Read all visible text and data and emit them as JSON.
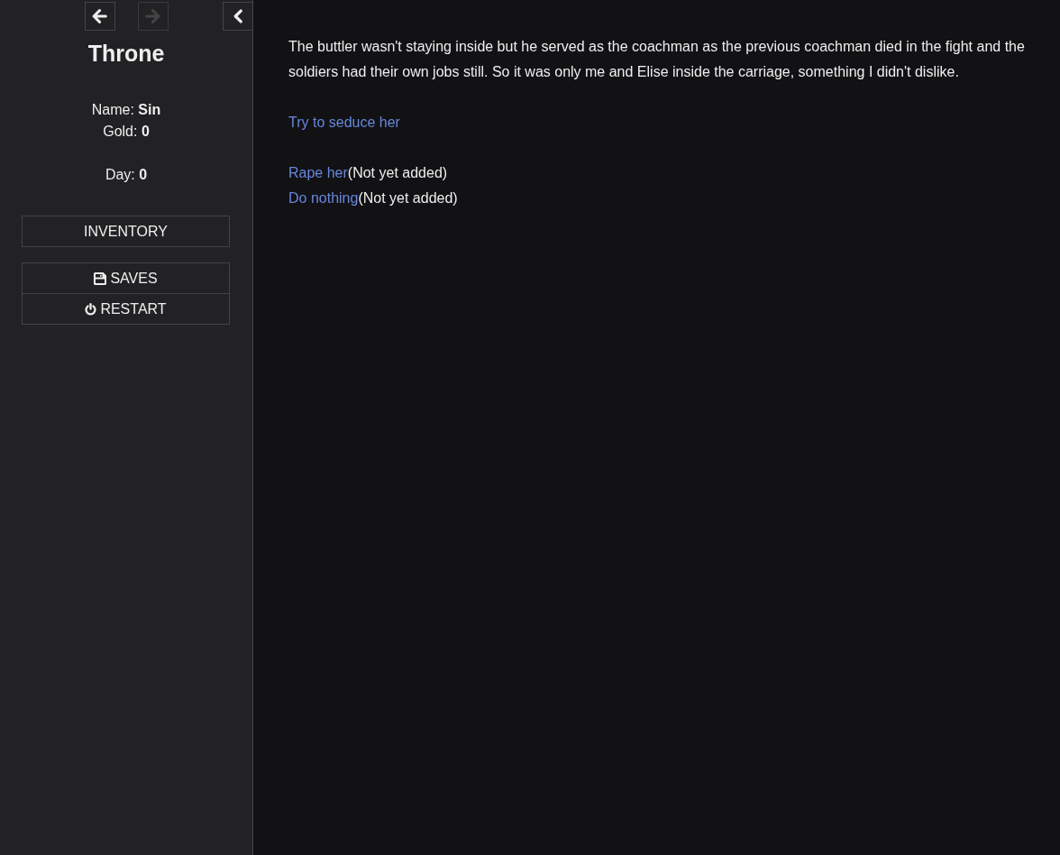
{
  "sidebar": {
    "history": [
      {
        "kind": "back",
        "disabled": false
      },
      {
        "kind": "forward",
        "disabled": true
      }
    ],
    "story_title": "Throne",
    "stat_groups": [
      [
        {
          "label": "Name:",
          "value": "Sin"
        },
        {
          "label": "Gold:",
          "value": "0"
        }
      ],
      [
        {
          "label": "Day:",
          "value": "0"
        }
      ]
    ],
    "menus": [
      [
        {
          "kind": "inventory",
          "label": "INVENTORY"
        }
      ],
      [
        {
          "kind": "saves",
          "label": "SAVES"
        },
        {
          "kind": "restart",
          "label": "RESTART"
        }
      ]
    ]
  },
  "passage": {
    "text": "The buttler wasn't staying inside but he served as the coachman as the previous coachman died in the fight and the soldiers had their own jobs still. So it was only me and Elise inside the carriage, something I didn't dislike.",
    "choice_groups": [
      [
        {
          "link": "Try to seduce her"
        }
      ],
      [
        {
          "link": "Rape her",
          "note": "(Not yet added)"
        },
        {
          "link": "Do nothing",
          "note": "(Not yet added)"
        }
      ]
    ]
  }
}
